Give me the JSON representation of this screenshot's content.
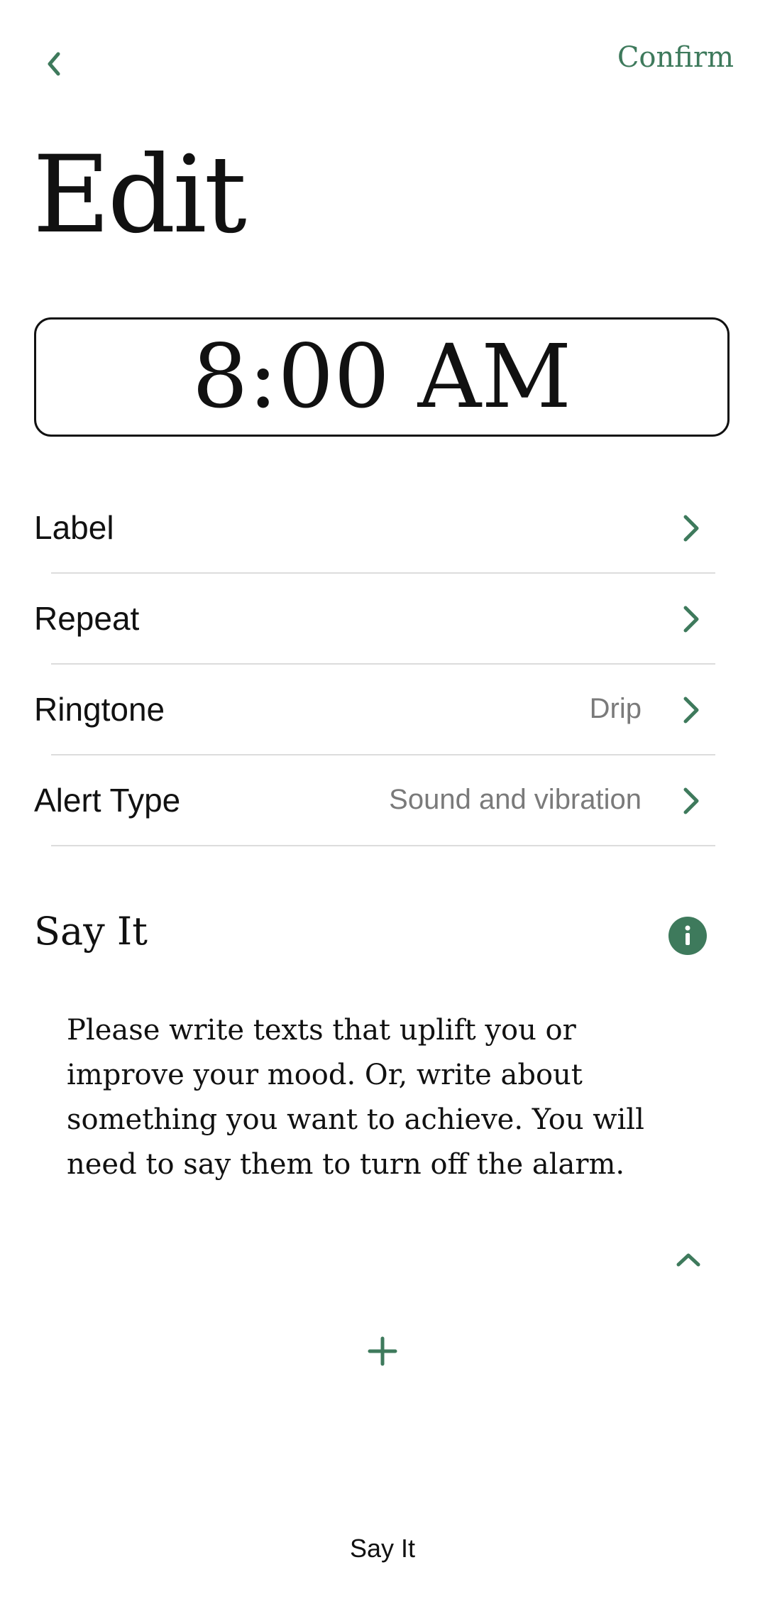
{
  "header": {
    "back_icon": "chevron-left-icon",
    "confirm_label": "Confirm",
    "title": "Edit"
  },
  "alarm": {
    "time": "8:00 AM"
  },
  "settings": {
    "items": [
      {
        "label": "Label",
        "value": "",
        "icon": "chevron-right-icon"
      },
      {
        "label": "Repeat",
        "value": "",
        "icon": "chevron-right-icon"
      },
      {
        "label": "Ringtone",
        "value": "Drip",
        "icon": "chevron-right-icon"
      },
      {
        "label": "Alert Type",
        "value": "Sound and vibration",
        "icon": "chevron-right-icon"
      }
    ]
  },
  "say_it": {
    "title": "Say It",
    "info_icon": "info-icon",
    "description": "Please write texts that uplift you or improve your mood. Or, write about something you want to achieve. You will need to say them to turn off the alarm.",
    "collapse_icon": "chevron-up-icon",
    "add_icon": "plus-icon"
  },
  "bottom": {
    "tab_label": "Say It"
  },
  "colors": {
    "accent": "#3e7a5c",
    "text": "#111111",
    "muted": "#7a7a7a",
    "divider": "#dcdcdc"
  }
}
